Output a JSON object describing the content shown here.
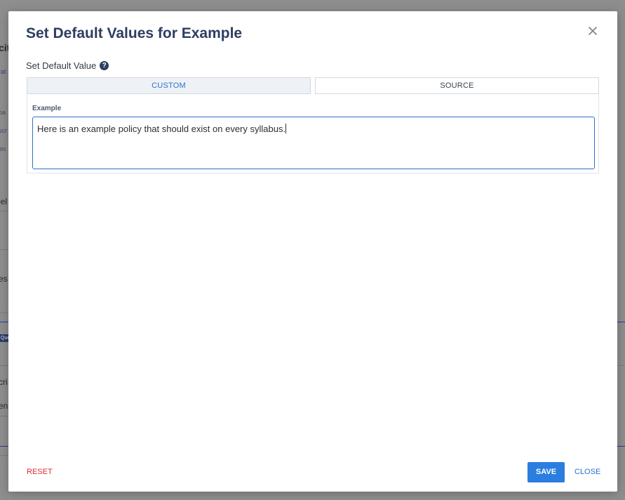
{
  "modal": {
    "title": "Set Default Values for Example",
    "close_icon": "close-icon"
  },
  "default_value": {
    "label": "Set Default Value",
    "help_icon": "question-circle-icon",
    "help_glyph": "?"
  },
  "tabs": [
    {
      "label": "CUSTOM",
      "selected": true
    },
    {
      "label": "SOURCE",
      "selected": false
    }
  ],
  "field": {
    "label": "Example",
    "value": "Here is an example policy that should exist on every syllabus."
  },
  "footer": {
    "reset_label": "RESET",
    "save_label": "SAVE",
    "close_label": "CLOSE"
  },
  "colors": {
    "title": "#2c3e62",
    "accent": "#2a7ee0",
    "link": "#2f70c9",
    "danger": "#d9302e"
  }
}
